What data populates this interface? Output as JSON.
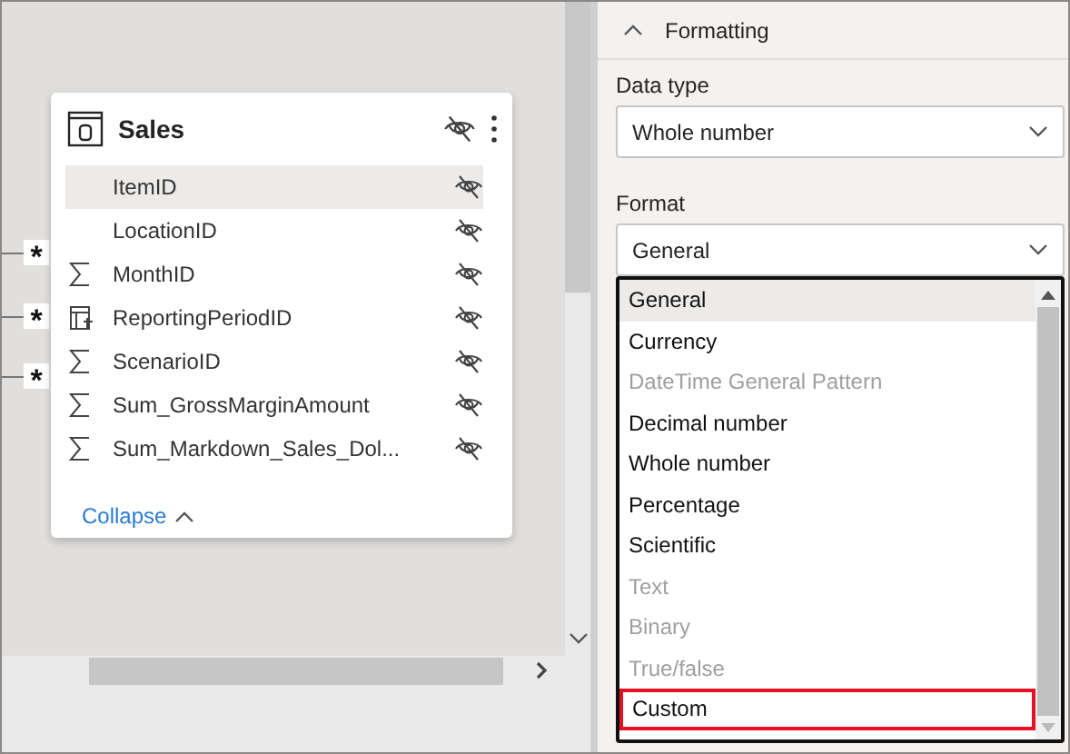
{
  "table_card": {
    "title": "Sales",
    "fields": [
      {
        "name": "ItemID",
        "kind": "plain",
        "highlighted": true
      },
      {
        "name": "LocationID",
        "kind": "plain",
        "highlighted": false
      },
      {
        "name": "MonthID",
        "kind": "sum",
        "highlighted": false
      },
      {
        "name": "ReportingPeriodID",
        "kind": "calc",
        "highlighted": false
      },
      {
        "name": "ScenarioID",
        "kind": "sum",
        "highlighted": false
      },
      {
        "name": "Sum_GrossMarginAmount",
        "kind": "sum",
        "highlighted": false
      },
      {
        "name": "Sum_Markdown_Sales_Dol...",
        "kind": "sum",
        "highlighted": false
      }
    ],
    "collapse_label": "Collapse"
  },
  "relationships": [
    {
      "cardinality": "*"
    },
    {
      "cardinality": "*"
    },
    {
      "cardinality": "*"
    }
  ],
  "properties": {
    "section_title": "Formatting",
    "expanded": true,
    "data_type": {
      "label": "Data type",
      "value": "Whole number"
    },
    "format": {
      "label": "Format",
      "value": "General",
      "options": [
        {
          "label": "General",
          "disabled": false,
          "selected": true,
          "outlined": false
        },
        {
          "label": "Currency",
          "disabled": false,
          "selected": false,
          "outlined": false
        },
        {
          "label": "DateTime General Pattern",
          "disabled": true,
          "selected": false,
          "outlined": false
        },
        {
          "label": "Decimal number",
          "disabled": false,
          "selected": false,
          "outlined": false
        },
        {
          "label": "Whole number",
          "disabled": false,
          "selected": false,
          "outlined": false
        },
        {
          "label": "Percentage",
          "disabled": false,
          "selected": false,
          "outlined": false
        },
        {
          "label": "Scientific",
          "disabled": false,
          "selected": false,
          "outlined": false
        },
        {
          "label": "Text",
          "disabled": true,
          "selected": false,
          "outlined": false
        },
        {
          "label": "Binary",
          "disabled": true,
          "selected": false,
          "outlined": false
        },
        {
          "label": "True/false",
          "disabled": true,
          "selected": false,
          "outlined": false
        },
        {
          "label": "Custom",
          "disabled": false,
          "selected": false,
          "outlined": true
        }
      ]
    }
  }
}
